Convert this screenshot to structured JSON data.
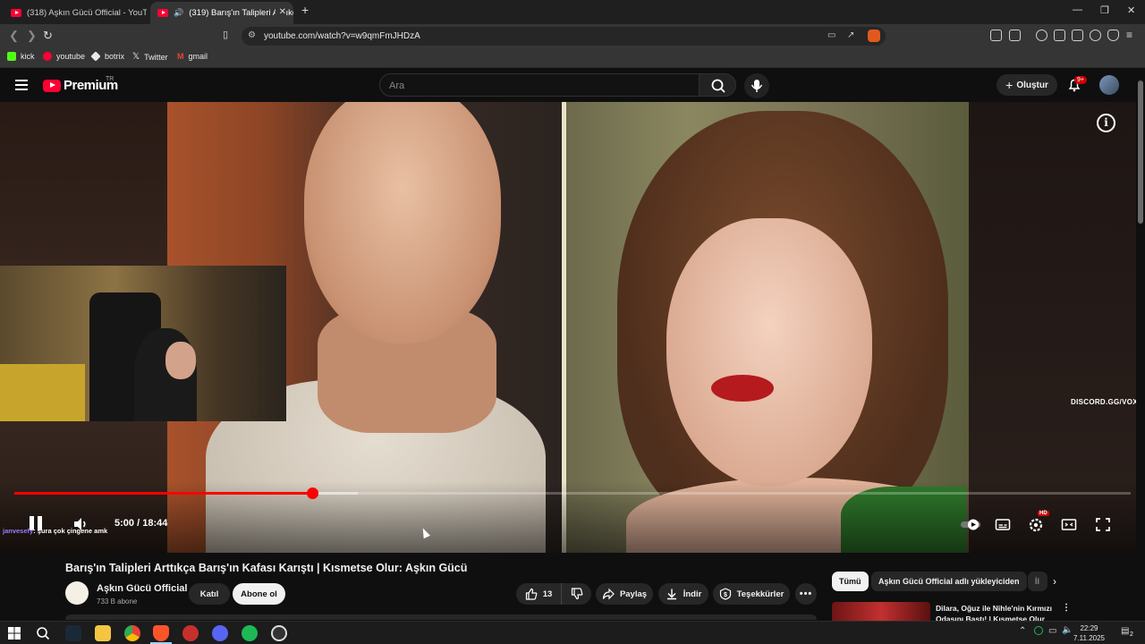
{
  "browser": {
    "tabs": [
      {
        "label": "(318) Aşkın Gücü Official - YouTube",
        "active": false
      },
      {
        "label": "(319) Barış'ın Talipleri Arttıkça",
        "active": true
      }
    ],
    "url": "youtube.com/watch?v=w9qmFmJHDzA",
    "bookmarks": [
      {
        "label": "kick",
        "icon": "kick-icon",
        "color": "#53fc18"
      },
      {
        "label": "youtube",
        "icon": "youtube-icon",
        "color": "#ff0033"
      },
      {
        "label": "botrix",
        "icon": "botrix-icon",
        "color": "#e8e8e8"
      },
      {
        "label": "Twitter",
        "icon": "x-icon",
        "color": "#e8e8e8"
      },
      {
        "label": "gmail",
        "icon": "gmail-icon",
        "color": "#ea4335"
      }
    ]
  },
  "youtube": {
    "logo_text": "Premium",
    "logo_region": "TR",
    "search_placeholder": "Ara",
    "create_label": "Oluştur",
    "notification_count": "9+"
  },
  "player": {
    "watermark": "DISCORD.GG/VOXZ",
    "current_time": "5:00",
    "separator": "/",
    "duration": "18:44",
    "progress_fraction": 0.267,
    "buffered_fraction": 0.308,
    "quality_badge": "HD",
    "chat": {
      "user": "janvesefy",
      "text": ": şura çok çingene amk"
    }
  },
  "video": {
    "title": "Barış'ın Talipleri Arttıkça Barış'ın Kafası Karıştı | Kısmetse Olur: Aşkın Gücü",
    "channel": "Aşkın Gücü Official",
    "subscribers": "733 B abone",
    "join_label": "Katıl",
    "subscribe_label": "Abone ol",
    "like_count": "13",
    "share_label": "Paylaş",
    "download_label": "İndir",
    "thanks_label": "Teşekkürler"
  },
  "sidebar": {
    "chips": [
      {
        "label": "Tümü",
        "active": true
      },
      {
        "label": "Aşkın Gücü Official adlı yükleyiciden",
        "active": false
      },
      {
        "label": "İl",
        "active": false
      }
    ],
    "recommended": [
      {
        "title": "Dilara, Oğuz ile Nihle'nin Kırmızı Odasını Bastı! | Kısmetse Olur"
      }
    ]
  },
  "taskbar": {
    "time": "22:29",
    "date": "7.11.2025",
    "notification_count": "2"
  }
}
